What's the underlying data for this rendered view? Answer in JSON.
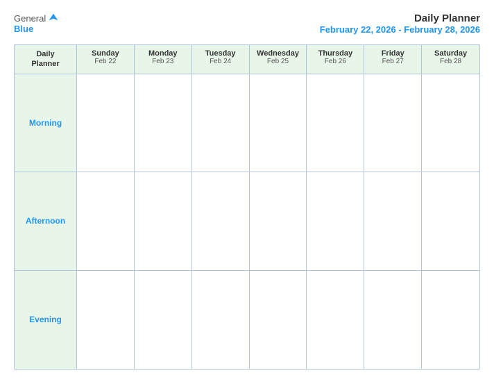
{
  "header": {
    "logo_general": "General",
    "logo_blue": "Blue",
    "title": "Daily Planner",
    "date_range": "February 22, 2026 - February 28, 2026"
  },
  "calendar": {
    "header_first_line": "Daily",
    "header_second_line": "Planner",
    "columns": [
      {
        "day": "Sunday",
        "date": "Feb 22"
      },
      {
        "day": "Monday",
        "date": "Feb 23"
      },
      {
        "day": "Tuesday",
        "date": "Feb 24"
      },
      {
        "day": "Wednesday",
        "date": "Feb 25"
      },
      {
        "day": "Thursday",
        "date": "Feb 26"
      },
      {
        "day": "Friday",
        "date": "Feb 27"
      },
      {
        "day": "Saturday",
        "date": "Feb 28"
      }
    ],
    "rows": [
      {
        "label": "Morning"
      },
      {
        "label": "Afternoon"
      },
      {
        "label": "Evening"
      }
    ]
  }
}
